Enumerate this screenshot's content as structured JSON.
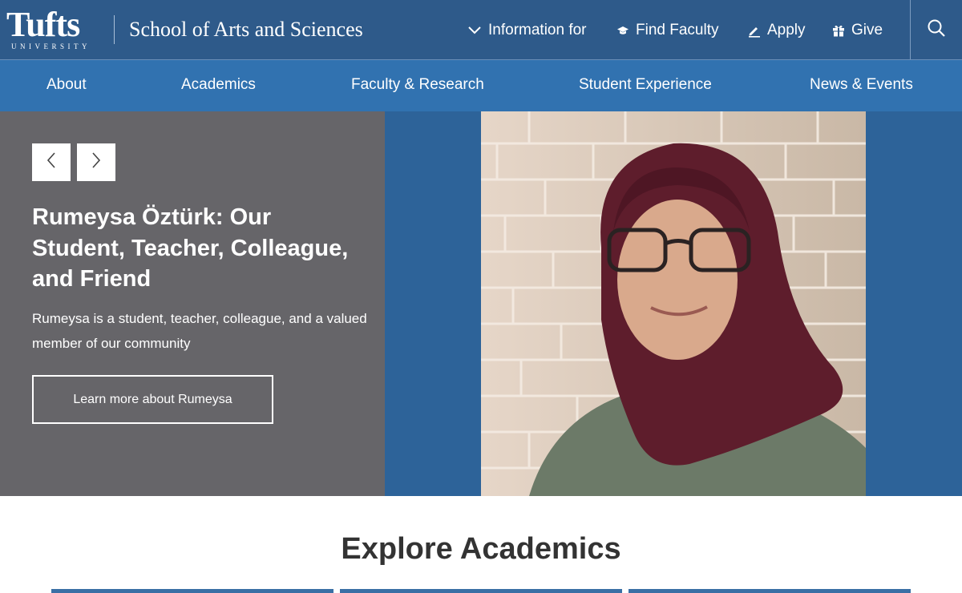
{
  "header": {
    "logo_word": "Tufts",
    "logo_sub": "UNIVERSITY",
    "school_name": "School of Arts and Sciences",
    "utility": {
      "information_for": "Information for",
      "find_faculty": "Find Faculty",
      "apply": "Apply",
      "give": "Give"
    }
  },
  "nav": {
    "items": [
      "About",
      "Academics",
      "Faculty & Research",
      "Student Experience",
      "News & Events"
    ]
  },
  "hero": {
    "title": "Rumeysa Öztürk: Our Student, Teacher, Colleague, and Friend",
    "description": "Rumeysa is a student, teacher, colleague, and a valued member of our community",
    "cta": "Learn more about Rumeysa"
  },
  "explore": {
    "title": "Explore Academics"
  },
  "colors": {
    "topbar": "#2e5a8a",
    "nav": "#3172b0",
    "hero_panel": "#666569",
    "hero_backdrop": "#2d6399",
    "card_bar": "#3a6fa5"
  },
  "icons": {
    "information_for": "chevron-down-icon",
    "find_faculty": "graduation-cap-icon",
    "apply": "pencil-icon",
    "give": "gift-icon",
    "search": "search-icon",
    "prev": "chevron-left-icon",
    "next": "chevron-right-icon"
  }
}
